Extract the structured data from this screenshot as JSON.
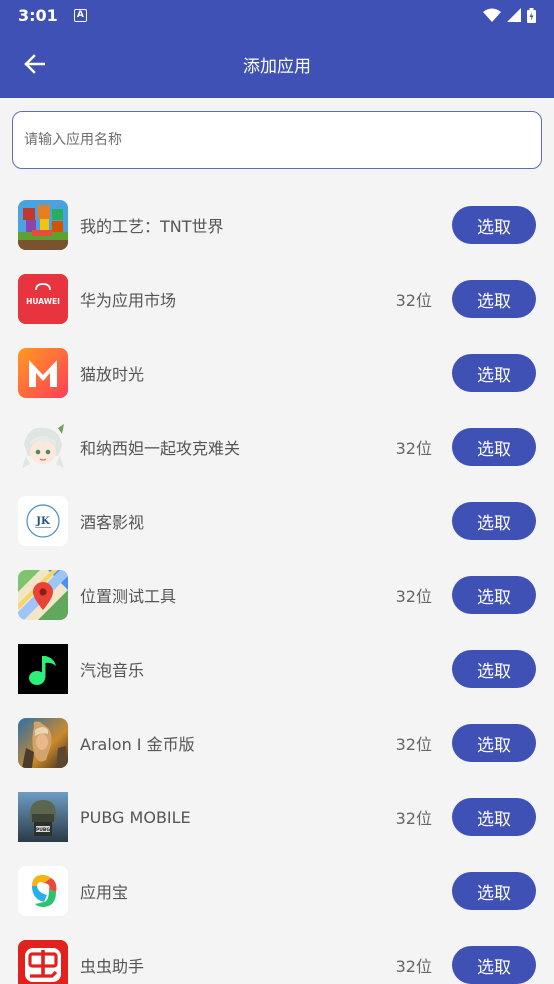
{
  "status_bar": {
    "time": "3:01",
    "notification_glyph": "A"
  },
  "toolbar": {
    "title": "添加应用"
  },
  "search": {
    "placeholder": "请输入应用名称",
    "value": ""
  },
  "select_label": "选取",
  "apps": [
    {
      "name": "我的工艺：TNT世界",
      "arch": "",
      "icon": "minecraft-style-game-icon"
    },
    {
      "name": "华为应用市场",
      "arch": "32位",
      "icon": "huawei-appgallery-icon"
    },
    {
      "name": "猫放时光",
      "arch": "",
      "icon": "letter-m-app-icon"
    },
    {
      "name": "和纳西妲一起攻克难关",
      "arch": "32位",
      "icon": "anime-character-icon"
    },
    {
      "name": "酒客影视",
      "arch": "",
      "icon": "jk-logo-icon"
    },
    {
      "name": "位置测试工具",
      "arch": "32位",
      "icon": "map-pin-icon"
    },
    {
      "name": "汽泡音乐",
      "arch": "",
      "icon": "music-note-icon"
    },
    {
      "name": "Aralon I 金币版",
      "arch": "32位",
      "icon": "fantasy-warrior-icon"
    },
    {
      "name": "PUBG MOBILE",
      "arch": "32位",
      "icon": "pubg-helmet-icon"
    },
    {
      "name": "应用宝",
      "arch": "",
      "icon": "yingyongbao-icon"
    },
    {
      "name": "虫虫助手",
      "arch": "32位",
      "icon": "chongchong-helper-icon"
    }
  ],
  "colors": {
    "primary": "#3f51b5",
    "background": "#f4f4f4",
    "search_border": "#5c6bc0"
  }
}
